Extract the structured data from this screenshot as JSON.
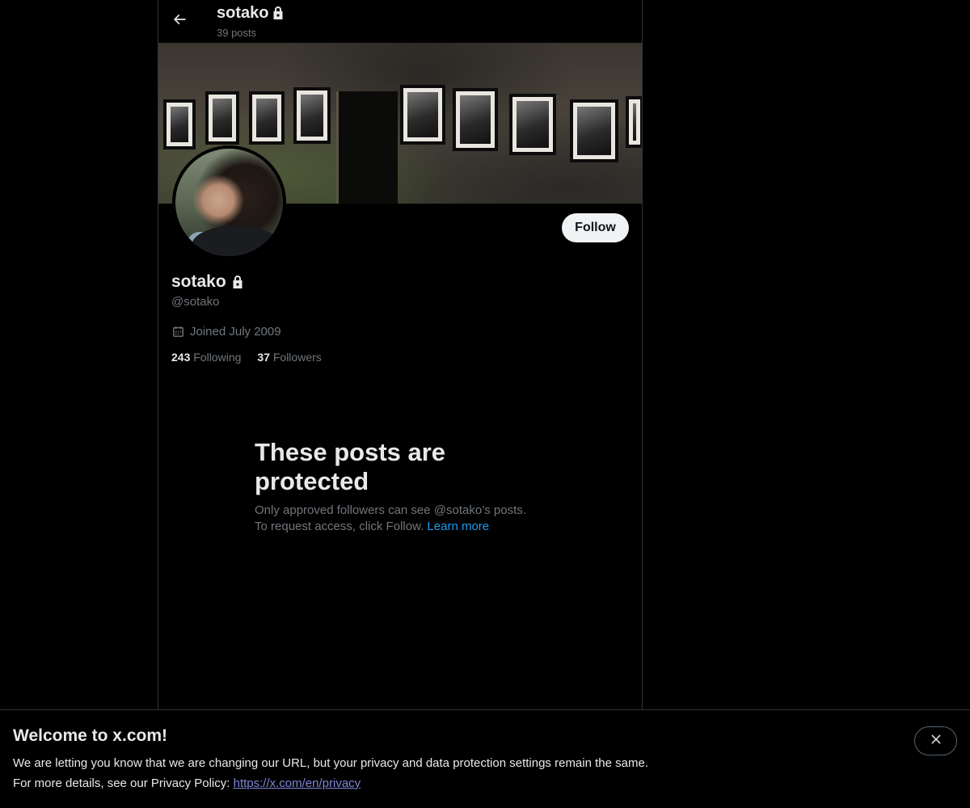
{
  "header": {
    "title": "sotako",
    "posts_count": "39 posts"
  },
  "profile": {
    "display_name": "sotako",
    "handle": "@sotako",
    "joined": "Joined July 2009",
    "following_count": "243",
    "following_label": "Following",
    "followers_count": "37",
    "followers_label": "Followers",
    "follow_label": "Follow"
  },
  "protected": {
    "title": "These posts are protected",
    "line1": "Only approved followers can see @sotako’s posts.",
    "line2": "To request access, click Follow.",
    "learn_more": "Learn more"
  },
  "notice": {
    "title": "Welcome to x.com!",
    "line1": "We are letting you know that we are changing our URL, but your privacy and data protection settings remain the same.",
    "line2_prefix": "For more details, see our Privacy Policy:",
    "link": "https://x.com/en/privacy"
  },
  "icons": {
    "back": "arrow-left-icon",
    "lock": "lock-icon",
    "calendar": "calendar-icon",
    "close": "close-icon"
  },
  "colors": {
    "background": "#000000",
    "primary_text": "#e7e9ea",
    "secondary_text": "#71767b",
    "link": "#1d9bf0",
    "button_bg": "#eff3f4"
  }
}
